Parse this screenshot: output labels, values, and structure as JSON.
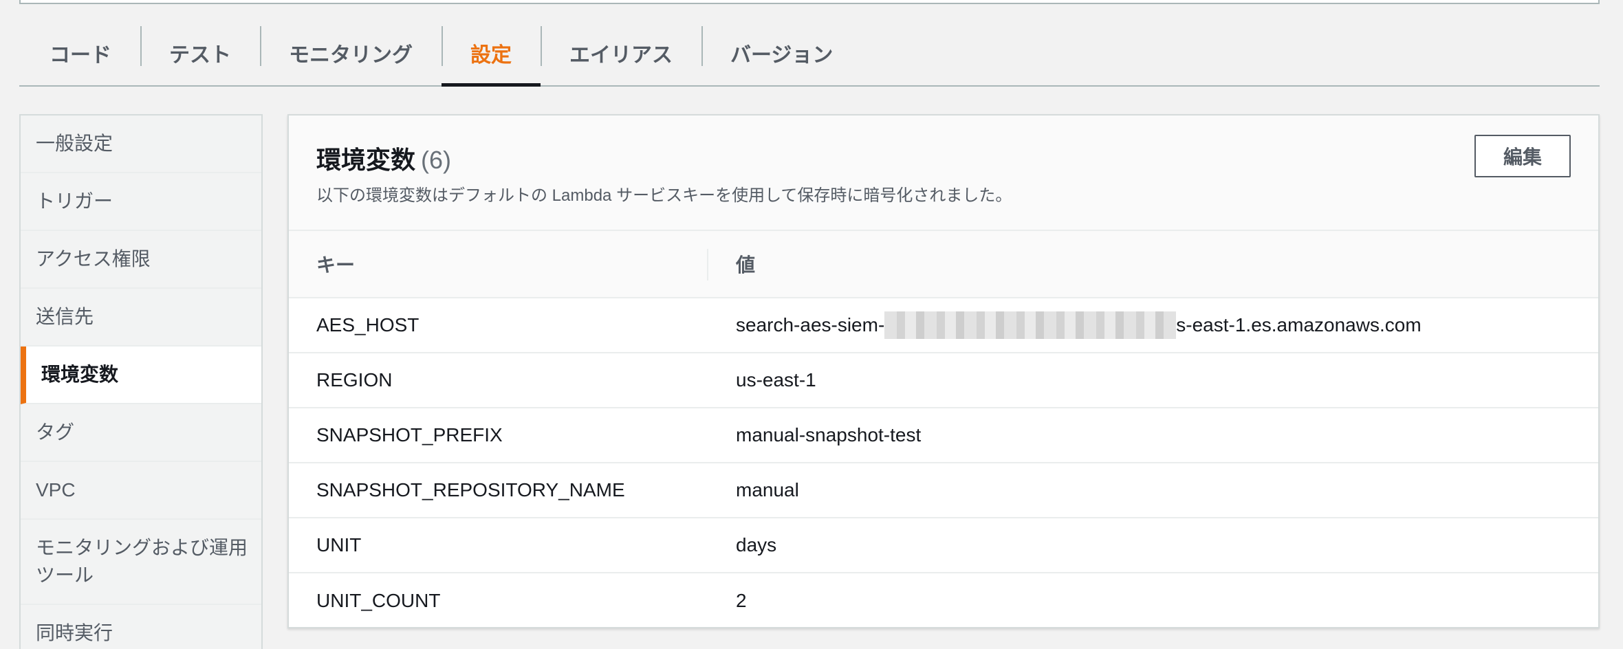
{
  "tabs": [
    {
      "label": "コード"
    },
    {
      "label": "テスト"
    },
    {
      "label": "モニタリング"
    },
    {
      "label": "設定"
    },
    {
      "label": "エイリアス"
    },
    {
      "label": "バージョン"
    }
  ],
  "active_tab": "設定",
  "sidebar": {
    "items": [
      {
        "label": "一般設定"
      },
      {
        "label": "トリガー"
      },
      {
        "label": "アクセス権限"
      },
      {
        "label": "送信先"
      },
      {
        "label": "環境変数"
      },
      {
        "label": "タグ"
      },
      {
        "label": "VPC"
      },
      {
        "label": "モニタリングおよび運用ツール"
      },
      {
        "label": "同時実行"
      }
    ],
    "active": "環境変数"
  },
  "panel": {
    "title": "環境変数",
    "count": "(6)",
    "description": "以下の環境変数はデフォルトの Lambda サービスキーを使用して保存時に暗号化されました。",
    "edit_label": "編集",
    "columns": {
      "key": "キー",
      "value": "値"
    },
    "rows": [
      {
        "key": "AES_HOST",
        "value_prefix": "search-aes-siem-",
        "value_suffix": "s-east-1.es.amazonaws.com"
      },
      {
        "key": "REGION",
        "value": "us-east-1"
      },
      {
        "key": "SNAPSHOT_PREFIX",
        "value": "manual-snapshot-test"
      },
      {
        "key": "SNAPSHOT_REPOSITORY_NAME",
        "value": "manual"
      },
      {
        "key": "UNIT",
        "value": "days"
      },
      {
        "key": "UNIT_COUNT",
        "value": "2"
      }
    ]
  },
  "colors": {
    "accent": "#ec7211",
    "text": "#16191f",
    "muted": "#545b64"
  }
}
